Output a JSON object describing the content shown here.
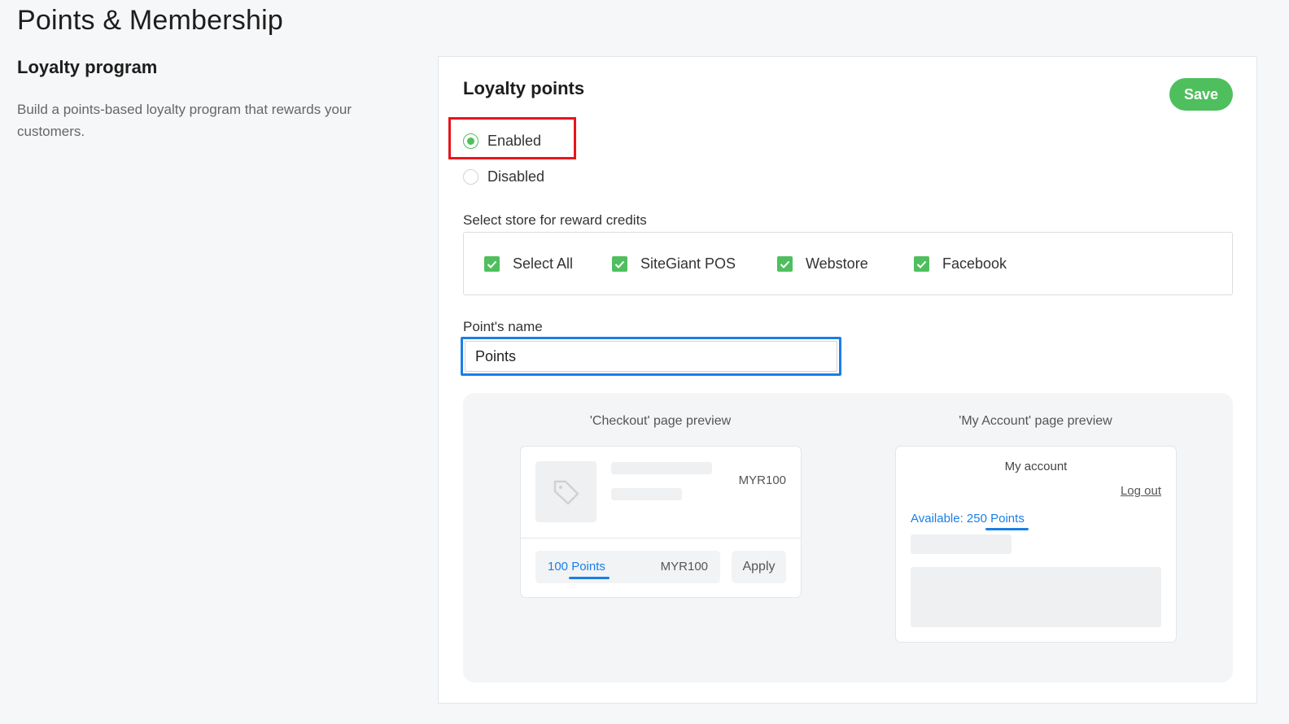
{
  "page": {
    "title": "Points & Membership"
  },
  "section": {
    "title": "Loyalty program",
    "description": "Build a points-based loyalty program that rewards your customers."
  },
  "card": {
    "title": "Loyalty points",
    "save_label": "Save",
    "status_options": [
      {
        "label": "Enabled",
        "checked": true
      },
      {
        "label": "Disabled",
        "checked": false
      }
    ],
    "store_label": "Select store for reward credits",
    "stores": [
      {
        "label": "Select All",
        "checked": true
      },
      {
        "label": "SiteGiant POS",
        "checked": true
      },
      {
        "label": "Webstore",
        "checked": true
      },
      {
        "label": "Facebook",
        "checked": true
      }
    ],
    "points_name_label": "Point's name",
    "points_name_value": "Points"
  },
  "preview": {
    "checkout": {
      "label": "'Checkout' page preview",
      "price": "MYR100",
      "points_text": "100 Points",
      "points_price": "MYR100",
      "apply_label": "Apply"
    },
    "account": {
      "label": "'My Account' page preview",
      "heading": "My account",
      "logout_label": "Log out",
      "available_text": "Available: 250 Points"
    }
  },
  "colors": {
    "accent_green": "#4fbf5e",
    "link_blue": "#1a7ee8",
    "highlight_red": "#e8141c"
  }
}
